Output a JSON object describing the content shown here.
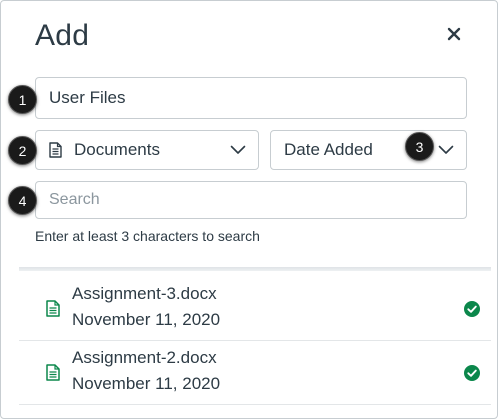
{
  "dialog": {
    "title": "Add",
    "close_icon": "close-icon"
  },
  "fields": {
    "location_value": "User Files",
    "type_value": "Documents",
    "type_icon": "document-icon",
    "sort_value": "Date Added",
    "search_placeholder": "Search",
    "hint": "Enter at least 3 characters to search"
  },
  "files": [
    {
      "name": "Assignment-3.docx",
      "date": "November 11, 2020",
      "icon": "docx-file-icon",
      "status_icon": "check-circle-icon"
    },
    {
      "name": "Assignment-2.docx",
      "date": "November 11, 2020",
      "icon": "docx-file-icon",
      "status_icon": "check-circle-icon"
    }
  ],
  "callouts": [
    "1",
    "2",
    "3",
    "4"
  ],
  "colors": {
    "text": "#2d3b45",
    "border": "#c7cdd1",
    "file_icon": "#0b874b",
    "check": "#0b874b",
    "callout_bg": "#1a1a1a"
  }
}
